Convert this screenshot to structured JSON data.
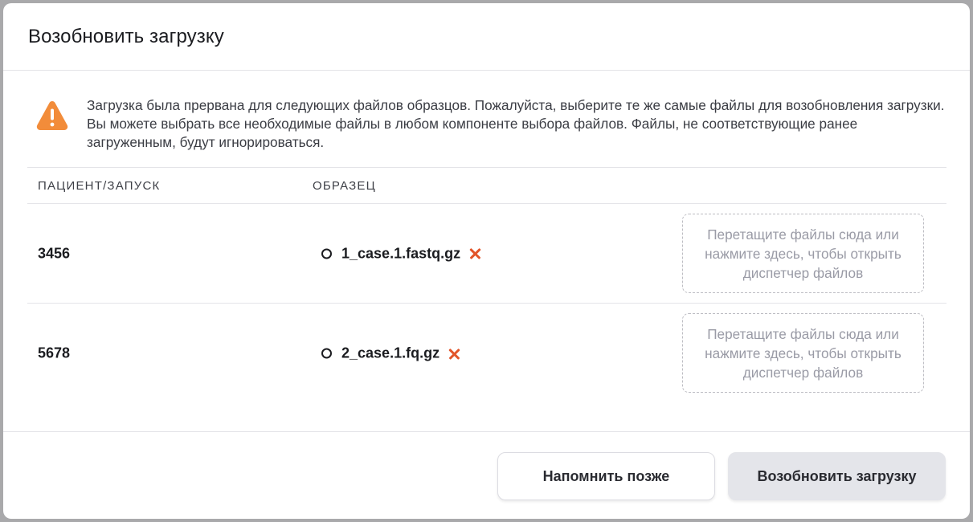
{
  "modal": {
    "title": "Возобновить загрузку"
  },
  "warning": {
    "icon": "warning-triangle-icon",
    "color": "#f28c3a",
    "text": "Загрузка была прервана для следующих файлов образцов. Пожалуйста, выберите те же самые файлы для возобновления загрузки. Вы можете выбрать все необходимые файлы в любом компоненте выбора файлов. Файлы, не соответствующие ранее загруженным, будут игнорироваться."
  },
  "table": {
    "headers": {
      "patient": "ПАЦИЕНТ/ЗАПУСК",
      "sample": "ОБРАЗЕЦ"
    },
    "rows": [
      {
        "patient": "3456",
        "file": "1_case.1.fastq.gz",
        "dropzone": "Перетащите файлы сюда или нажмите здесь, чтобы открыть диспетчер файлов"
      },
      {
        "patient": "5678",
        "file": "2_case.1.fq.gz",
        "dropzone": "Перетащите файлы сюда или нажмите здесь, чтобы открыть диспетчер файлов"
      }
    ]
  },
  "footer": {
    "remind_later_label": "Напомнить позже",
    "resume_label": "Возобновить загрузку"
  },
  "colors": {
    "remove_accent": "#e2552a",
    "warning": "#f28c3a"
  }
}
